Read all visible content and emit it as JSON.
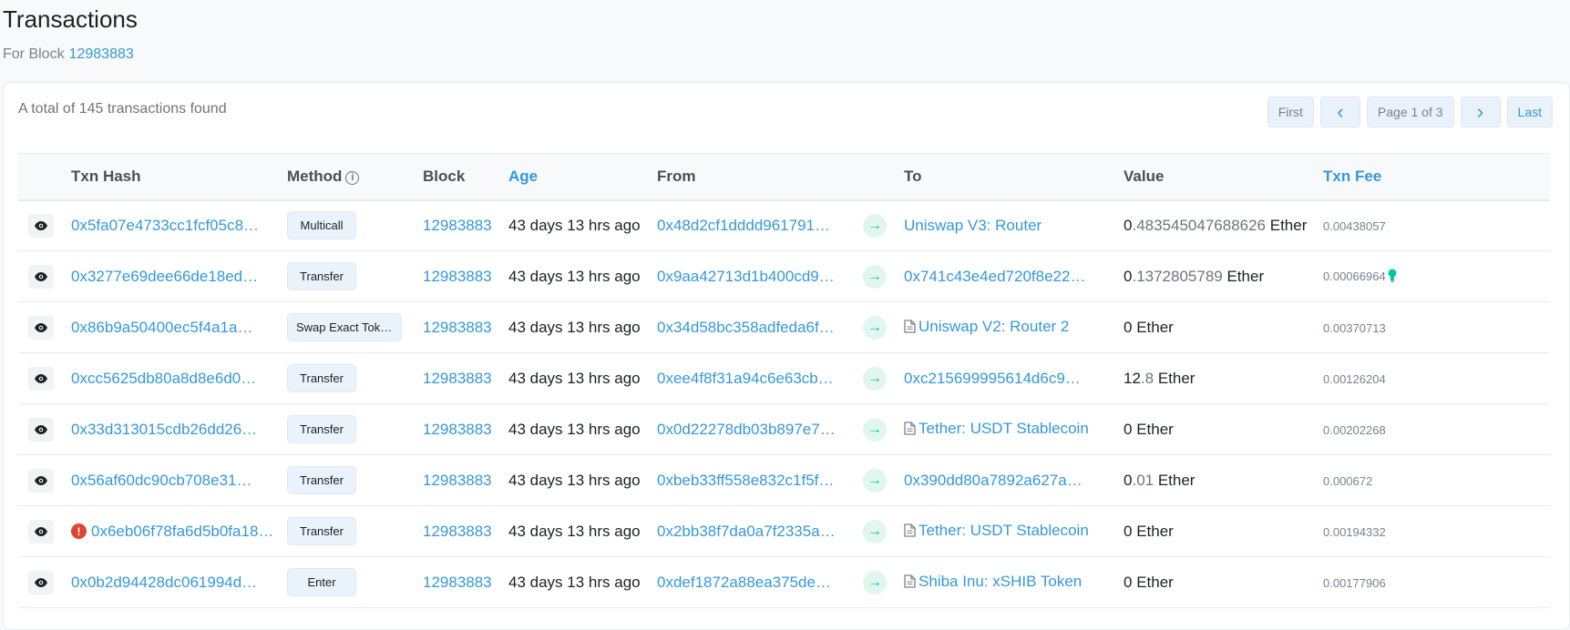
{
  "page": {
    "title": "Transactions",
    "subtitle_prefix": "For Block",
    "block_number": "12983883"
  },
  "card": {
    "total_text": "A total of 145 transactions found",
    "pager": {
      "first": "First",
      "prev": "‹",
      "info": "Page 1 of 3",
      "next": "›",
      "last": "Last"
    }
  },
  "table": {
    "headers": {
      "txn_hash": "Txn Hash",
      "method": "Method",
      "block": "Block",
      "age": "Age",
      "from": "From",
      "to": "To",
      "value": "Value",
      "txn_fee": "Txn Fee"
    },
    "rows": [
      {
        "hash": "0x5fa07e4733cc1fcf05c8…",
        "method": "Multicall",
        "block": "12983883",
        "age": "43 days 13 hrs ago",
        "from": "0x48d2cf1dddd9617916…",
        "to": "Uniswap V3: Router",
        "to_contract": false,
        "value_int": "0",
        "value_dec": ".483545047688626",
        "value_unit": " Ether",
        "fee": "0.00438057",
        "error": false,
        "bulb": false
      },
      {
        "hash": "0x3277e69dee66de18ed…",
        "method": "Transfer",
        "block": "12983883",
        "age": "43 days 13 hrs ago",
        "from": "0x9aa42713d1b400cd93…",
        "to": "0x741c43e4ed720f8e22…",
        "to_contract": false,
        "value_int": "0",
        "value_dec": ".1372805789",
        "value_unit": " Ether",
        "fee": "0.00066964",
        "error": false,
        "bulb": true
      },
      {
        "hash": "0x86b9a50400ec5f4a1a…",
        "method": "Swap Exact Token…",
        "block": "12983883",
        "age": "43 days 13 hrs ago",
        "from": "0x34d58bc358adfeda6fd…",
        "to": "Uniswap V2: Router 2",
        "to_contract": true,
        "value_int": "0",
        "value_dec": "",
        "value_unit": " Ether",
        "fee": "0.00370713",
        "error": false,
        "bulb": false
      },
      {
        "hash": "0xcc5625db80a8d8e6d0…",
        "method": "Transfer",
        "block": "12983883",
        "age": "43 days 13 hrs ago",
        "from": "0xee4f8f31a94c6e63cb9…",
        "to": "0xc215699995614d6c9d…",
        "to_contract": false,
        "value_int": "12",
        "value_dec": ".8",
        "value_unit": " Ether",
        "fee": "0.00126204",
        "error": false,
        "bulb": false
      },
      {
        "hash": "0x33d313015cdb26dd26…",
        "method": "Transfer",
        "block": "12983883",
        "age": "43 days 13 hrs ago",
        "from": "0x0d22278db03b897e75…",
        "to": "Tether: USDT Stablecoin",
        "to_contract": true,
        "value_int": "0",
        "value_dec": "",
        "value_unit": " Ether",
        "fee": "0.00202268",
        "error": false,
        "bulb": false
      },
      {
        "hash": "0x56af60dc90cb708e31…",
        "method": "Transfer",
        "block": "12983883",
        "age": "43 days 13 hrs ago",
        "from": "0xbeb33ff558e832c1f5fb…",
        "to": "0x390dd80a7892a627a1…",
        "to_contract": false,
        "value_int": "0",
        "value_dec": ".01",
        "value_unit": " Ether",
        "fee": "0.000672",
        "error": false,
        "bulb": false
      },
      {
        "hash": "0x6eb06f78fa6d5b0fa18…",
        "method": "Transfer",
        "block": "12983883",
        "age": "43 days 13 hrs ago",
        "from": "0x2bb38f7da0a7f2335a7…",
        "to": "Tether: USDT Stablecoin",
        "to_contract": true,
        "value_int": "0",
        "value_dec": "",
        "value_unit": " Ether",
        "fee": "0.00194332",
        "error": true,
        "bulb": false
      },
      {
        "hash": "0x0b2d94428dc061994d…",
        "method": "Enter",
        "block": "12983883",
        "age": "43 days 13 hrs ago",
        "from": "0xdef1872a88ea375de7…",
        "to": "Shiba Inu: xSHIB Token",
        "to_contract": true,
        "value_int": "0",
        "value_dec": "",
        "value_unit": " Ether",
        "fee": "0.00177906",
        "error": false,
        "bulb": false
      }
    ]
  },
  "colors": {
    "link": "#3498db",
    "error": "#de4437",
    "direction_in": "#00c9a7"
  },
  "icons": {
    "view": "eye-icon",
    "info": "info-circle-icon",
    "direction": "arrow-right-icon",
    "contract": "file-document-icon",
    "error": "exclamation-circle-icon",
    "fee_hint": "lightbulb-icon"
  }
}
